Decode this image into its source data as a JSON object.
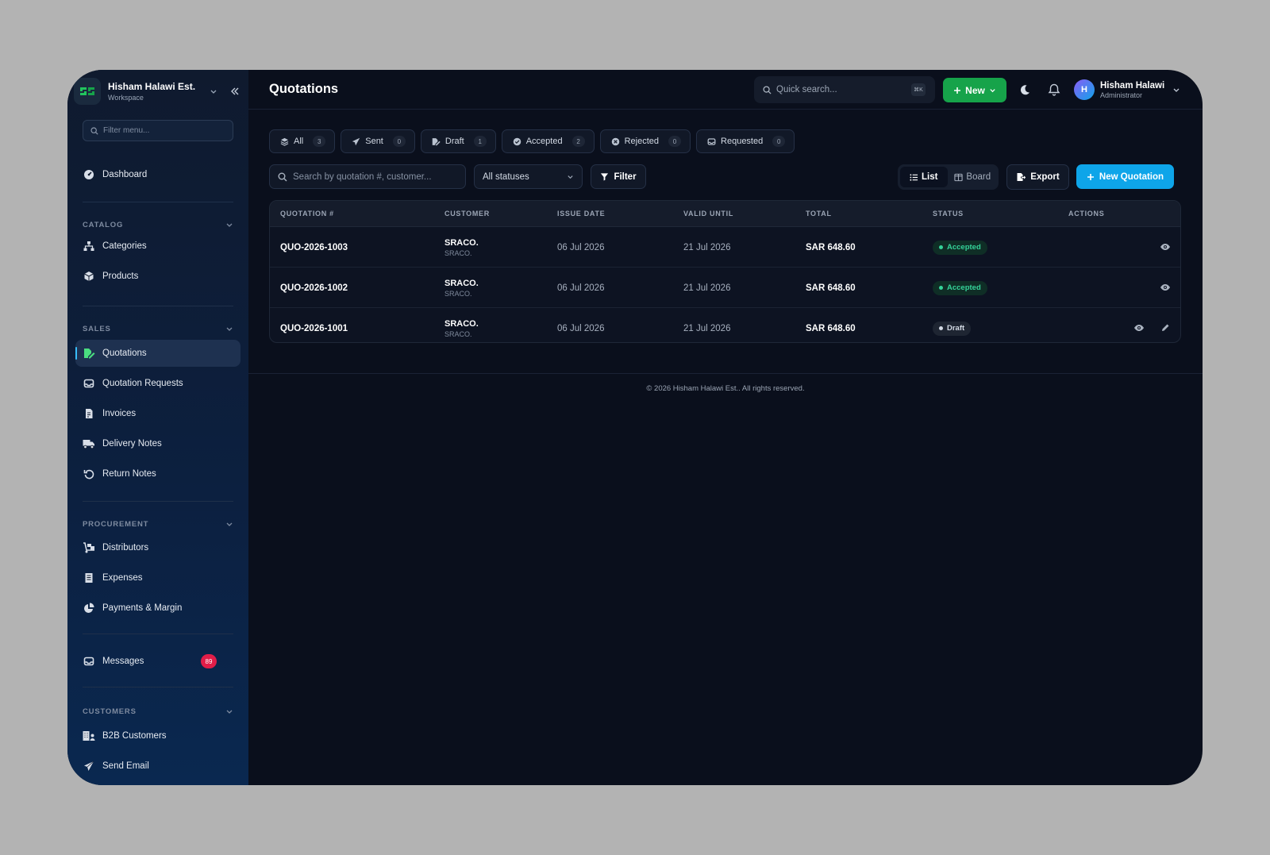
{
  "workspace": {
    "name": "Hisham Halawi Est.",
    "subtitle": "Workspace"
  },
  "sidebar": {
    "filter_placeholder": "Filter menu...",
    "dashboard": "Dashboard",
    "sections": {
      "catalog": "CATALOG",
      "sales": "SALES",
      "procurement": "PROCUREMENT",
      "customers": "CUSTOMERS"
    },
    "items": {
      "categories": "Categories",
      "products": "Products",
      "quotations": "Quotations",
      "quotation_requests": "Quotation Requests",
      "invoices": "Invoices",
      "delivery_notes": "Delivery Notes",
      "return_notes": "Return Notes",
      "distributors": "Distributors",
      "expenses": "Expenses",
      "payments_margin": "Payments & Margin",
      "messages": "Messages",
      "b2b_customers": "B2B Customers",
      "send_email": "Send Email"
    },
    "messages_badge": "89"
  },
  "header": {
    "title": "Quotations",
    "search_placeholder": "Quick search...",
    "shortcut": "⌘K",
    "new_label": "New",
    "user": {
      "initial": "H",
      "name": "Hisham Halawi",
      "role": "Administrator"
    }
  },
  "tabs": [
    {
      "label": "All",
      "count": "3"
    },
    {
      "label": "Sent",
      "count": "0"
    },
    {
      "label": "Draft",
      "count": "1"
    },
    {
      "label": "Accepted",
      "count": "2"
    },
    {
      "label": "Rejected",
      "count": "0"
    },
    {
      "label": "Requested",
      "count": "0"
    }
  ],
  "toolbar": {
    "search_placeholder": "Search by quotation #, customer...",
    "status_select": "All statuses",
    "filter": "Filter",
    "list": "List",
    "board": "Board",
    "export": "Export",
    "new_quotation": "New Quotation"
  },
  "table": {
    "columns": [
      "QUOTATION #",
      "CUSTOMER",
      "ISSUE DATE",
      "VALID UNTIL",
      "TOTAL",
      "STATUS",
      "ACTIONS"
    ],
    "rows": [
      {
        "number": "QUO-2026-1003",
        "customer": "SRACO.",
        "customer_sub": "SRACO.",
        "issue": "06 Jul 2026",
        "valid": "21 Jul 2026",
        "total": "SAR 648.60",
        "status": "Accepted"
      },
      {
        "number": "QUO-2026-1002",
        "customer": "SRACO.",
        "customer_sub": "SRACO.",
        "issue": "06 Jul 2026",
        "valid": "21 Jul 2026",
        "total": "SAR 648.60",
        "status": "Accepted"
      },
      {
        "number": "QUO-2026-1001",
        "customer": "SRACO.",
        "customer_sub": "SRACO.",
        "issue": "06 Jul 2026",
        "valid": "21 Jul 2026",
        "total": "SAR 648.60",
        "status": "Draft"
      }
    ]
  },
  "footer": "© 2026 Hisham Halawi Est.. All rights reserved.",
  "colors": {
    "accent": "#0ea5e9",
    "new_button": "#16a34a",
    "accepted": "#34d399",
    "badge": "#e11d48"
  }
}
